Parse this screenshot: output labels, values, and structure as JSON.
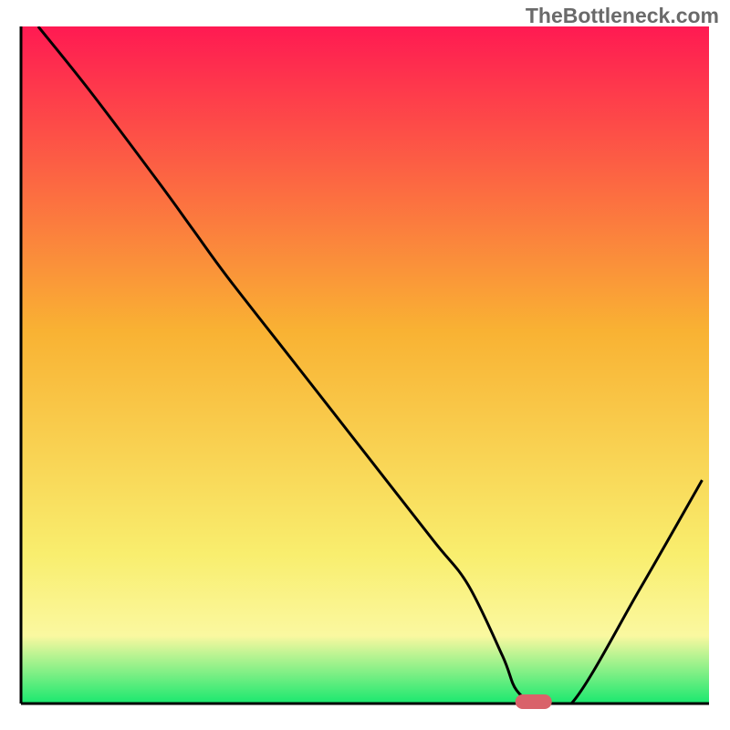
{
  "watermark": "TheBottleneck.com",
  "colors": {
    "gradient_top": "#ff1a52",
    "gradient_mid": "#f9b233",
    "gradient_low": "#f9ee6e",
    "gradient_bottom": "#19e86f",
    "axis": "#000000",
    "curve": "#000000",
    "marker": "#d9626a"
  },
  "chart_data": {
    "type": "line",
    "title": "",
    "xlabel": "",
    "ylabel": "",
    "xlim": [
      0,
      100
    ],
    "ylim": [
      0,
      100
    ],
    "x": [
      2.5,
      10,
      20,
      25,
      30,
      40,
      50,
      60,
      65,
      70,
      72,
      75,
      80,
      90,
      99
    ],
    "y": [
      100,
      90.5,
      77,
      70,
      63,
      50,
      37,
      24,
      17.5,
      7,
      2,
      0,
      0,
      17,
      33
    ],
    "marker": {
      "x": 74.5,
      "y": 0
    },
    "annotations": []
  },
  "axes": {
    "x_tick_labels": [],
    "y_tick_labels": []
  }
}
